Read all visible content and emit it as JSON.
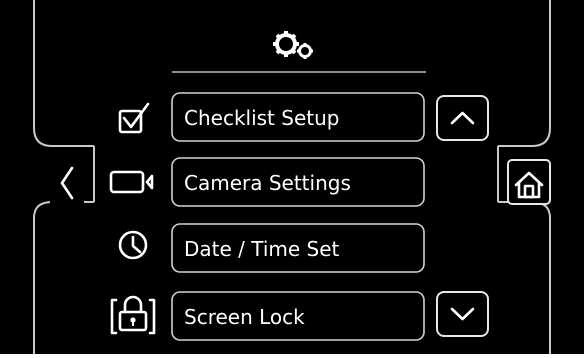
{
  "header": {
    "settings_icon": "gears-icon"
  },
  "menu": {
    "items": [
      {
        "label": "Checklist Setup",
        "icon": "checkbox-icon"
      },
      {
        "label": "Camera Settings",
        "icon": "camera-icon"
      },
      {
        "label": "Date / Time Set",
        "icon": "clock-icon"
      },
      {
        "label": "Screen Lock",
        "icon": "padlock-icon"
      }
    ]
  },
  "nav": {
    "back_icon": "chevron-left-icon",
    "home_icon": "home-icon",
    "scroll_up_icon": "chevron-up-icon",
    "scroll_down_icon": "chevron-down-icon"
  },
  "colors": {
    "background": "#000000",
    "frame": "#c9c9c9",
    "text": "#ffffff"
  }
}
